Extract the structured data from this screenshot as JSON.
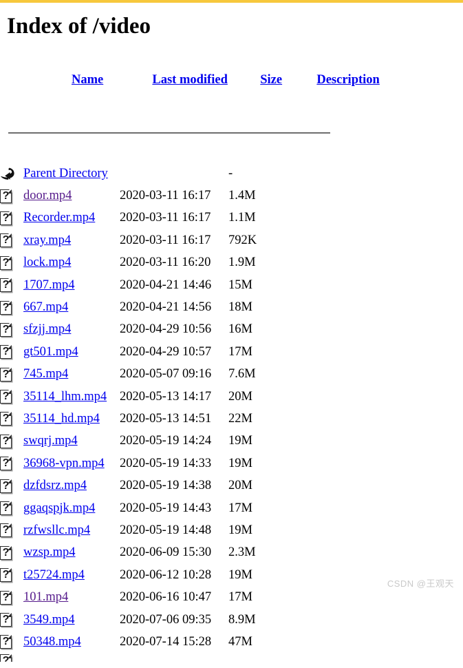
{
  "theme": {
    "top_bar_color": "#f7c83c",
    "link_color": "#0000ee",
    "visited_link_color": "#551a8b",
    "rule_color": "#6e6e6e",
    "background": "#ffffff",
    "watermark_color": "#c9c9c9"
  },
  "page": {
    "title": "Index of /video"
  },
  "table": {
    "headers": {
      "name": "Name",
      "last_modified": "Last modified",
      "size": "Size",
      "description": "Description"
    },
    "parent": {
      "icon": "back-arrow-icon",
      "label": "Parent Directory",
      "last_modified": "",
      "size": "-",
      "description": ""
    },
    "rows": [
      {
        "icon": "unknown-file-icon",
        "name": "door.mp4",
        "last_modified": "2020-03-11 16:17",
        "size": "1.4M",
        "description": "",
        "visited": true
      },
      {
        "icon": "unknown-file-icon",
        "name": "Recorder.mp4",
        "last_modified": "2020-03-11 16:17",
        "size": "1.1M",
        "description": "",
        "visited": false
      },
      {
        "icon": "unknown-file-icon",
        "name": "xray.mp4",
        "last_modified": "2020-03-11 16:17",
        "size": "792K",
        "description": "",
        "visited": false
      },
      {
        "icon": "unknown-file-icon",
        "name": "lock.mp4",
        "last_modified": "2020-03-11 16:20",
        "size": "1.9M",
        "description": "",
        "visited": false
      },
      {
        "icon": "unknown-file-icon",
        "name": "1707.mp4",
        "last_modified": "2020-04-21 14:46",
        "size": "15M",
        "description": "",
        "visited": false
      },
      {
        "icon": "unknown-file-icon",
        "name": "667.mp4",
        "last_modified": "2020-04-21 14:56",
        "size": "18M",
        "description": "",
        "visited": false
      },
      {
        "icon": "unknown-file-icon",
        "name": "sfzjj.mp4",
        "last_modified": "2020-04-29 10:56",
        "size": "16M",
        "description": "",
        "visited": false
      },
      {
        "icon": "unknown-file-icon",
        "name": "gt501.mp4",
        "last_modified": "2020-04-29 10:57",
        "size": "17M",
        "description": "",
        "visited": false
      },
      {
        "icon": "unknown-file-icon",
        "name": "745.mp4",
        "last_modified": "2020-05-07 09:16",
        "size": "7.6M",
        "description": "",
        "visited": false
      },
      {
        "icon": "unknown-file-icon",
        "name": "35114_lhm.mp4",
        "last_modified": "2020-05-13 14:17",
        "size": "20M",
        "description": "",
        "visited": false
      },
      {
        "icon": "unknown-file-icon",
        "name": "35114_hd.mp4",
        "last_modified": "2020-05-13 14:51",
        "size": "22M",
        "description": "",
        "visited": false
      },
      {
        "icon": "unknown-file-icon",
        "name": "swqrj.mp4",
        "last_modified": "2020-05-19 14:24",
        "size": "19M",
        "description": "",
        "visited": false
      },
      {
        "icon": "unknown-file-icon",
        "name": "36968-vpn.mp4",
        "last_modified": "2020-05-19 14:33",
        "size": "19M",
        "description": "",
        "visited": false
      },
      {
        "icon": "unknown-file-icon",
        "name": "dzfdsrz.mp4",
        "last_modified": "2020-05-19 14:38",
        "size": "20M",
        "description": "",
        "visited": false
      },
      {
        "icon": "unknown-file-icon",
        "name": "ggaqspjk.mp4",
        "last_modified": "2020-05-19 14:43",
        "size": "17M",
        "description": "",
        "visited": false
      },
      {
        "icon": "unknown-file-icon",
        "name": "rzfwsllc.mp4",
        "last_modified": "2020-05-19 14:48",
        "size": "19M",
        "description": "",
        "visited": false
      },
      {
        "icon": "unknown-file-icon",
        "name": "wzsp.mp4",
        "last_modified": "2020-06-09 15:30",
        "size": "2.3M",
        "description": "",
        "visited": false
      },
      {
        "icon": "unknown-file-icon",
        "name": "t25724.mp4",
        "last_modified": "2020-06-12 10:28",
        "size": "19M",
        "description": "",
        "visited": false
      },
      {
        "icon": "unknown-file-icon",
        "name": "101.mp4",
        "last_modified": "2020-06-16 10:47",
        "size": "17M",
        "description": "",
        "visited": true
      },
      {
        "icon": "unknown-file-icon",
        "name": "3549.mp4",
        "last_modified": "2020-07-06 09:35",
        "size": "8.9M",
        "description": "",
        "visited": false
      },
      {
        "icon": "unknown-file-icon",
        "name": "50348.mp4",
        "last_modified": "2020-07-14 15:28",
        "size": "47M",
        "description": "",
        "visited": false
      }
    ]
  },
  "watermark": {
    "text": "CSDN @王观天"
  }
}
